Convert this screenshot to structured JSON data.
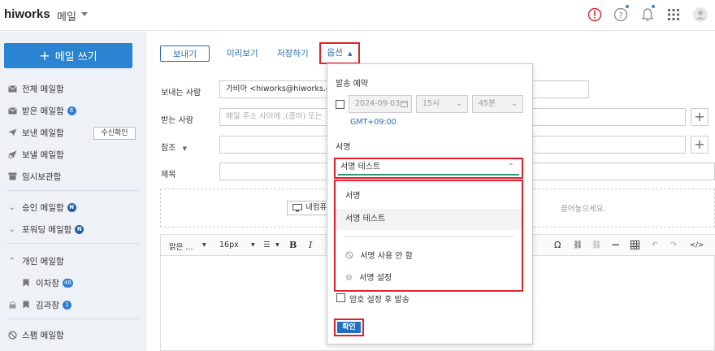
{
  "app": {
    "logo": "hiworks",
    "name": "메일"
  },
  "sidebar": {
    "compose_label": "메일 쓰기",
    "items": [
      {
        "label": "전체 메일함",
        "icon": "mail-icon"
      },
      {
        "label": "받은 메일함",
        "icon": "mail-icon",
        "badge": "6"
      },
      {
        "label": "보낸 메일함",
        "icon": "send-icon",
        "button": "수신확인"
      },
      {
        "label": "보낼 메일함",
        "icon": "scheduled-send-icon"
      },
      {
        "label": "임시보관함",
        "icon": "archive-icon"
      }
    ],
    "groups": [
      {
        "label": "승인 메일함",
        "badge": "N"
      },
      {
        "label": "포워딩 메일함",
        "badge": "N"
      },
      {
        "label": "개인 메일함"
      }
    ],
    "personal": [
      {
        "label": "이차장",
        "badge": "46"
      },
      {
        "label": "김과장",
        "badge": "1"
      }
    ],
    "spam": "스팸 메일함"
  },
  "toolbar": {
    "send": "보내기",
    "preview": "미리보기",
    "save": "저장하기",
    "options": "옵션"
  },
  "form": {
    "from_label": "보내는 사람",
    "from_value": "가비아 <hiworks@hiworks.com>",
    "to_label": "받는 사람",
    "to_placeholder": "메일 주소 사이에 ,(콤마) 또는",
    "cc_label": "참조",
    "subject_label": "제목"
  },
  "attach": {
    "button": "내컴퓨터",
    "hint": "끌어놓으세요."
  },
  "editor": {
    "font": "맑은 ...",
    "size": "16px"
  },
  "options_panel": {
    "schedule_label": "발송 예약",
    "date": "2024-09-03",
    "hour": "15시",
    "minute": "45분",
    "timezone": "GMT+09:00",
    "signature_label": "서명",
    "signature_selected": "서명 테스트",
    "signature_options": [
      "서명",
      "서명 테스트",
      "서명 사용 안 함",
      "서명 설정"
    ],
    "password_send": "암호 설정 후 발송",
    "confirm": "확인"
  },
  "colors": {
    "accent": "#2a84d2",
    "highlight": "#e0202c",
    "sidebar_bg": "#eef2f7"
  }
}
